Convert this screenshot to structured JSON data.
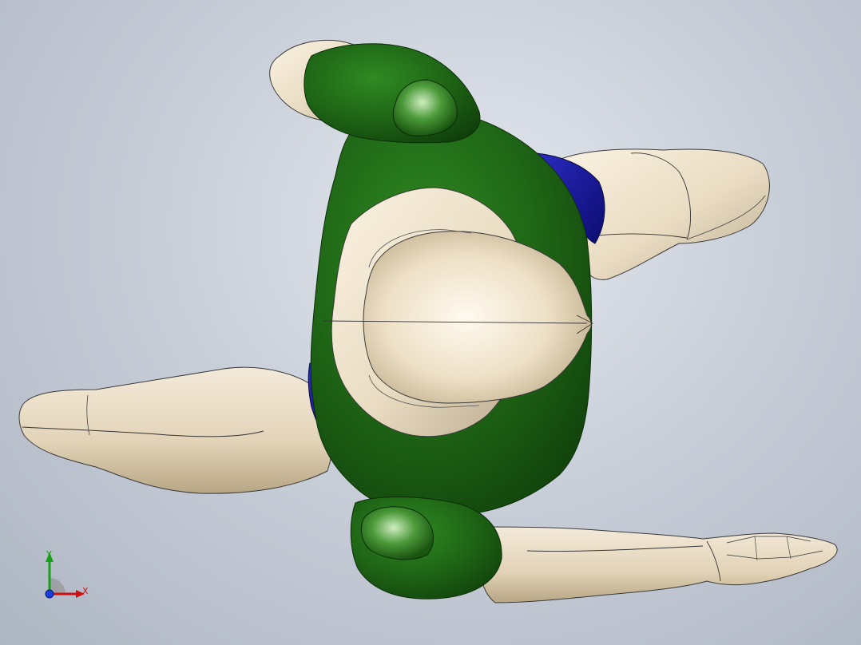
{
  "viewport": {
    "background": "#c9cfd9",
    "model": {
      "skin_color": "#eee0c8",
      "shirt_color": "#1f6616",
      "pants_color": "#1a1aa0",
      "edge_color": "#2a2a2a"
    }
  },
  "triad": {
    "x_label": "X",
    "y_label": "Y",
    "x_color": "#d01010",
    "y_color": "#18a018",
    "z_color": "#1a3cd8"
  }
}
